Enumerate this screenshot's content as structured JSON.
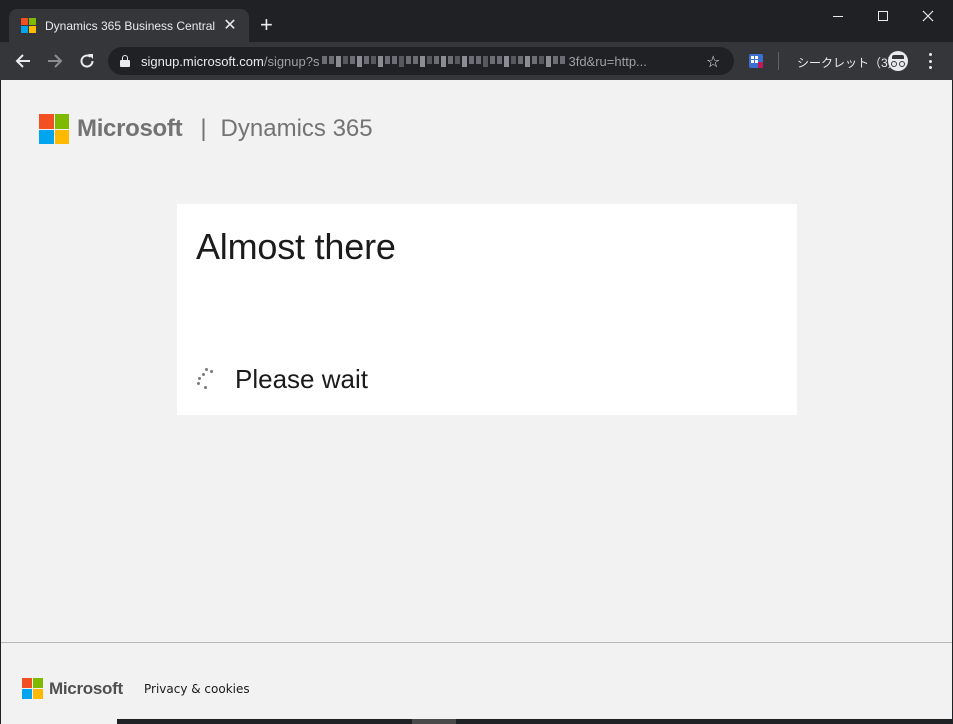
{
  "browser": {
    "tab": {
      "title": "Dynamics 365 Business Central",
      "close_glyph": "✕",
      "favicon": "microsoft-logo"
    },
    "new_tab_glyph": "+",
    "window_controls": [
      "minimize-icon",
      "maximize-icon",
      "close-icon"
    ],
    "address_bar": {
      "host": "signup.microsoft.com",
      "path_prefix": "/signup?s",
      "path_suffix": "3fd&ru=http..."
    },
    "bookmark_glyph": "☆",
    "incognito_label": "シークレット（3）"
  },
  "page": {
    "brand": {
      "company": "Microsoft",
      "separator": "|",
      "product": "Dynamics 365"
    },
    "card": {
      "title": "Almost there",
      "status_text": "Please wait"
    },
    "footer": {
      "company": "Microsoft",
      "privacy_link": "Privacy & cookies"
    }
  },
  "colors": {
    "ms_red": "#f25022",
    "ms_green": "#7fba00",
    "ms_blue": "#00a4ef",
    "ms_yellow": "#ffb900",
    "page_background": "#f2f2f2",
    "chrome_dark": "#202124"
  }
}
